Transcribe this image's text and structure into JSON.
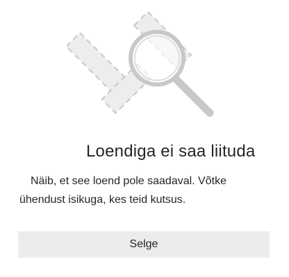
{
  "dialog": {
    "illustration_icon": "magnifier-over-broken-link-icon",
    "title": "Loendiga ei saa liituda",
    "message": "Näib, et see loend pole saadaval. Võtke ühendust isikuga, kes teid kutsus.",
    "ok_button_label": "Selge"
  },
  "colors": {
    "illustration_stroke": "#c8c8c8",
    "illustration_fill": "#ededed",
    "button_background": "#ececec",
    "text": "#252525"
  }
}
